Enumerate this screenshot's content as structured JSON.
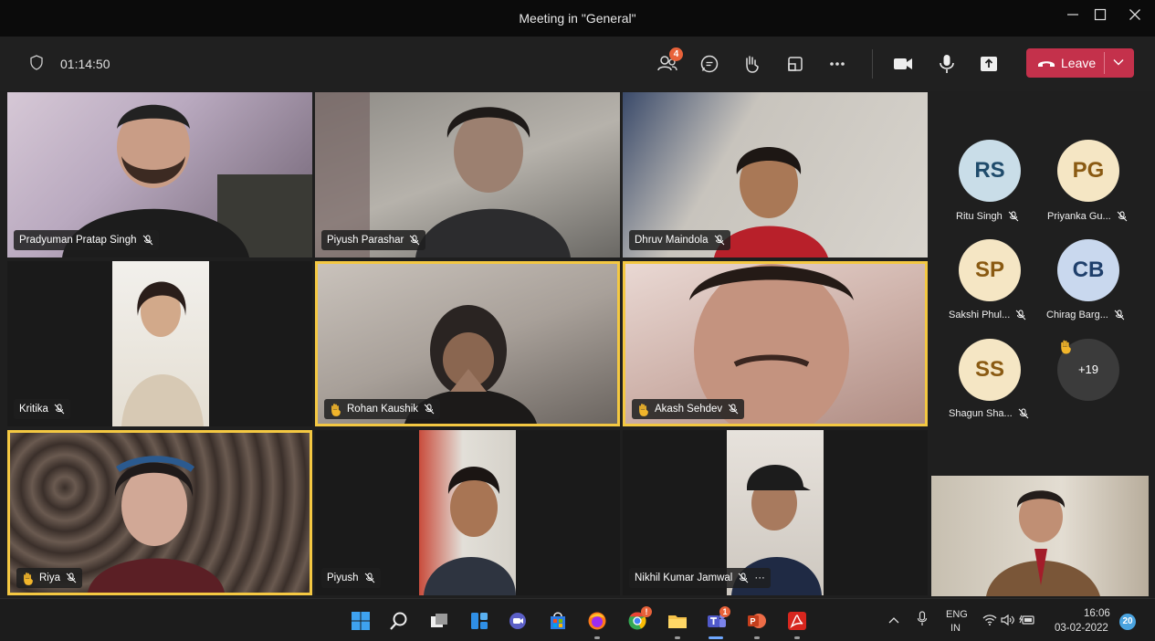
{
  "window": {
    "title": "Meeting in \"General\"",
    "controls": [
      "minimize-icon",
      "maximize-icon",
      "close-icon"
    ]
  },
  "toolbar": {
    "timer": "01:14:50",
    "participants_badge": "4",
    "leave_label": "Leave",
    "icons": [
      "people-icon",
      "chat-icon",
      "raise-hand-icon",
      "rooms-icon",
      "more-icon",
      "camera-icon",
      "mic-icon",
      "share-icon"
    ]
  },
  "tiles": [
    {
      "name": "Pradyuman Pratap Singh",
      "muted": true,
      "hand": false,
      "highlighted": false
    },
    {
      "name": "Piyush Parashar",
      "muted": true,
      "hand": false,
      "highlighted": false
    },
    {
      "name": "Dhruv Maindola",
      "muted": true,
      "hand": false,
      "highlighted": false
    },
    {
      "name": "Kritika",
      "muted": true,
      "hand": false,
      "highlighted": false
    },
    {
      "name": "Rohan Kaushik",
      "muted": true,
      "hand": true,
      "highlighted": true
    },
    {
      "name": "Akash Sehdev",
      "muted": true,
      "hand": true,
      "highlighted": true
    },
    {
      "name": "Riya",
      "muted": true,
      "hand": true,
      "highlighted": true
    },
    {
      "name": "Piyush",
      "muted": true,
      "hand": false,
      "highlighted": false
    },
    {
      "name": "Nikhil Kumar Jamwal",
      "muted": true,
      "hand": false,
      "highlighted": false,
      "more": "···"
    }
  ],
  "roster": [
    {
      "initials": "RS",
      "name": "Ritu Singh",
      "color": "#c9dde8",
      "text_color": "#1f4b6b"
    },
    {
      "initials": "PG",
      "name": "Priyanka Gu...",
      "color": "#f5e6c4",
      "text_color": "#8a5a12"
    },
    {
      "initials": "SP",
      "name": "Sakshi Phul...",
      "color": "#f5e6c4",
      "text_color": "#8a5a12"
    },
    {
      "initials": "CB",
      "name": "Chirag Barg...",
      "color": "#c9d8ee",
      "text_color": "#1f3f6b"
    },
    {
      "initials": "SS",
      "name": "Shagun Sha...",
      "color": "#f5e6c4",
      "text_color": "#8a5a12"
    }
  ],
  "overflow": {
    "label": "+19"
  },
  "taskbar": {
    "apps": [
      "windows-start-icon",
      "search-icon",
      "task-view-icon",
      "widgets-icon",
      "chat-app-icon",
      "store-icon",
      "firefox-icon",
      "chrome-icon",
      "file-explorer-icon",
      "teams-icon",
      "powerpoint-icon",
      "acrobat-icon"
    ],
    "chrome_badge": "!",
    "teams_badge": "1",
    "language": "ENG",
    "region": "IN",
    "time": "16:06",
    "date": "03-02-2022",
    "notification_count": "20"
  },
  "colors": {
    "accent_highlight": "#f4c842",
    "leave_red": "#c4314b",
    "toolbar_bg": "#202020",
    "titlebar_bg": "#0b0b0b"
  }
}
